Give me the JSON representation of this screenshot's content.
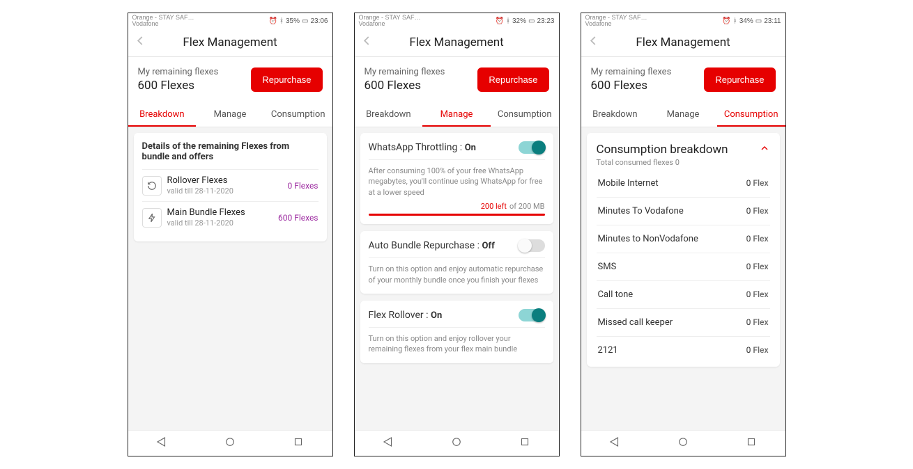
{
  "carrier_text": "Orange - STAY SAF…\nVodafone",
  "page_title": "Flex Management",
  "remaining_label": "My remaining flexes",
  "remaining_value": "600 Flexes",
  "repurchase_label": "Repurchase",
  "tabs": {
    "breakdown": "Breakdown",
    "manage": "Manage",
    "consumption": "Consumption"
  },
  "screens": [
    {
      "time": "23:06",
      "battery": "35%"
    },
    {
      "time": "23:23",
      "battery": "32%"
    },
    {
      "time": "23:11",
      "battery": "34%"
    }
  ],
  "breakdown": {
    "heading": "Details of the remaining Flexes from bundle and offers",
    "items": [
      {
        "name": "Rollover Flexes",
        "valid": "valid till 28-11-2020",
        "amount": "0 Flexes"
      },
      {
        "name": "Main Bundle Flexes",
        "valid": "valid till 28-11-2020",
        "amount": "600 Flexes"
      }
    ]
  },
  "manage": {
    "whatsapp": {
      "label": "WhatsApp Throttling :",
      "state": "On",
      "desc": "After consuming 100% of your free WhatsApp megabytes, you'll continue using WhatsApp for free at a lower speed",
      "progress_left": "200 left",
      "progress_total": "of 200 MB"
    },
    "auto": {
      "label": "Auto Bundle Repurchase :",
      "state": "Off",
      "desc": "Turn on this option and enjoy automatic repurchase of your monthly bundle once you finish your flexes"
    },
    "rollover": {
      "label": "Flex Rollover :",
      "state": "On",
      "desc": "Turn on this option and enjoy rollover your remaining flexes from your flex main bundle"
    }
  },
  "consumption": {
    "title": "Consumption breakdown",
    "subtitle": "Total consumed flexes 0",
    "rows": [
      {
        "name": "Mobile Internet",
        "value": "0",
        "unit": "Flex"
      },
      {
        "name": "Minutes To Vodafone",
        "value": "0",
        "unit": "Flex"
      },
      {
        "name": "Minutes to NonVodafone",
        "value": "0",
        "unit": "Flex"
      },
      {
        "name": "SMS",
        "value": "0",
        "unit": "Flex"
      },
      {
        "name": "Call tone",
        "value": "0",
        "unit": "Flex"
      },
      {
        "name": "Missed call keeper",
        "value": "0",
        "unit": "Flex"
      },
      {
        "name": "2121",
        "value": "0",
        "unit": "Flex"
      }
    ]
  }
}
